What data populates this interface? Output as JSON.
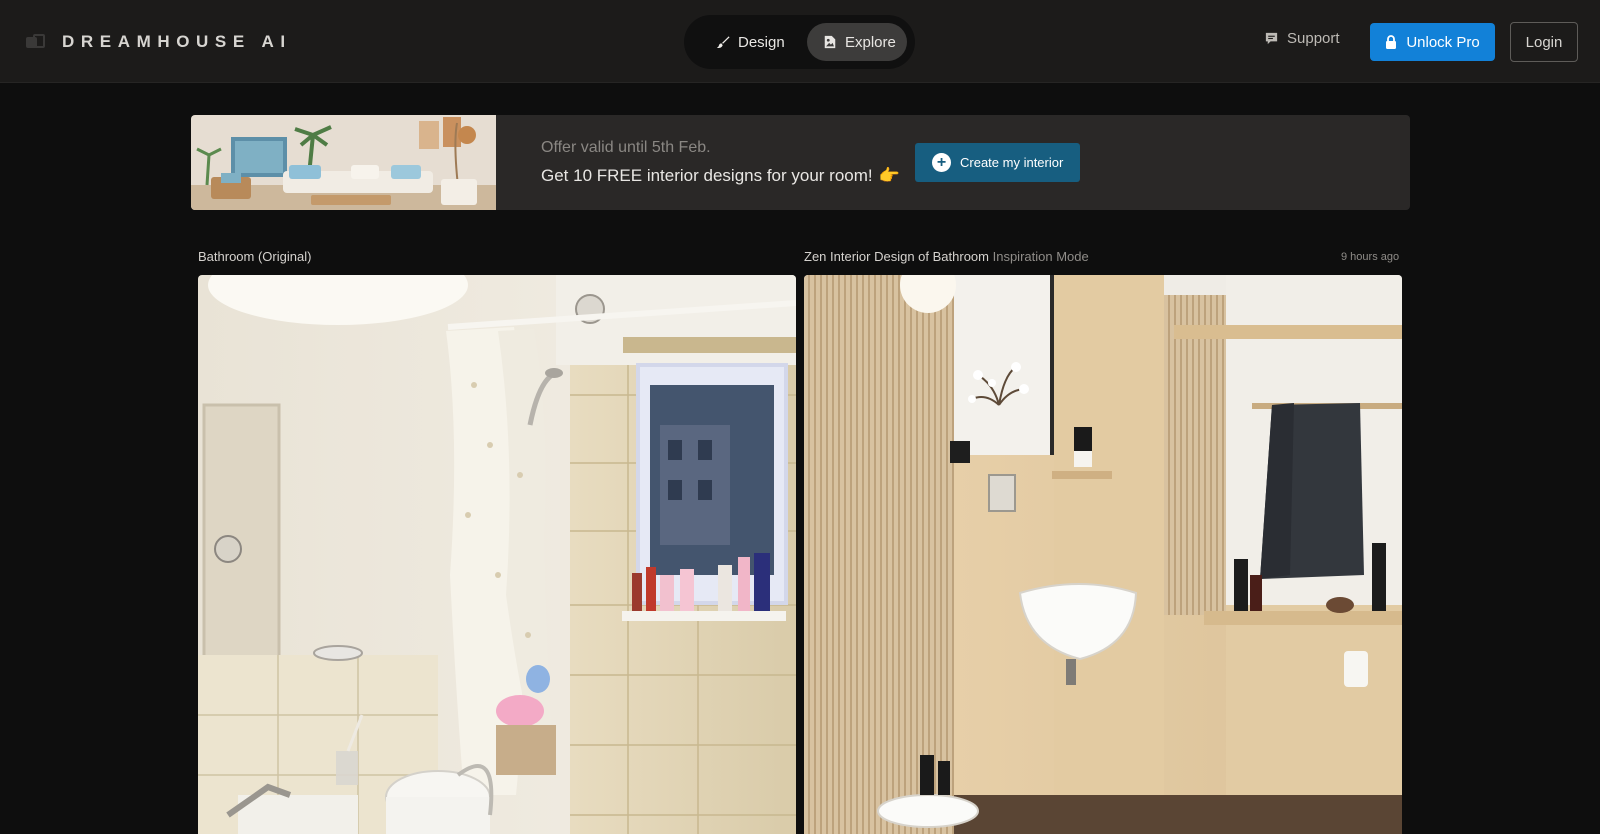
{
  "header": {
    "brand": "DREAMHOUSE AI",
    "nav": [
      {
        "label": "Design",
        "icon": "brush-icon",
        "active": false
      },
      {
        "label": "Explore",
        "icon": "gallery-icon",
        "active": true
      }
    ],
    "support_label": "Support",
    "unlock_label": "Unlock Pro",
    "login_label": "Login"
  },
  "banner": {
    "offer": "Offer valid until 5th Feb.",
    "promo": "Get 10 FREE interior designs for your room!",
    "promo_emoji": "👉",
    "cta_label": "Create my interior"
  },
  "gallery": {
    "original_caption": "Bathroom (Original)",
    "design_caption": "Zen Interior Design of Bathroom",
    "design_mode": "Inspiration Mode",
    "time_ago": "9 hours ago"
  },
  "colors": {
    "accent": "#1281d8",
    "cta": "#175e80",
    "background": "#0e0e0e",
    "header": "#1c1b1a"
  }
}
